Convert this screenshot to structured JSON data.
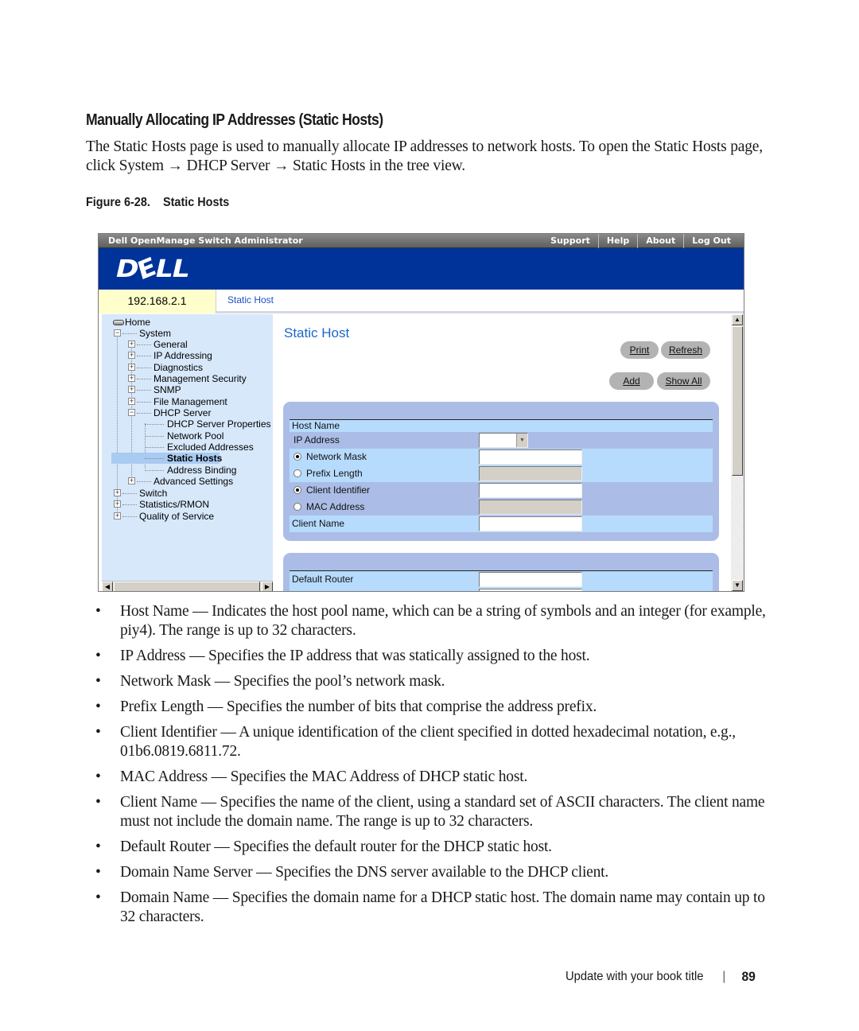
{
  "section_title": "Manually Allocating IP Addresses (Static Hosts)",
  "intro": {
    "p1": "The ",
    "b1": "Static Hosts",
    "p2": " page is used to manually allocate IP addresses to network hosts. To open the ",
    "b2": "Static Hosts",
    "p3": " page, click ",
    "b3": "System",
    "arrow1": " → ",
    "b4": "DHCP Server",
    "arrow2": " → ",
    "b5": "Static Hosts",
    "p4": " in the tree view."
  },
  "figure": {
    "number": "Figure 6-28.",
    "name": "Static Hosts"
  },
  "ui": {
    "app_title": "Dell OpenManage Switch Administrator",
    "top_links": [
      "Support",
      "Help",
      "About",
      "Log Out"
    ],
    "logo": {
      "d": "D",
      "e": "E",
      "ll": "LL"
    },
    "device_ip": "192.168.2.1",
    "breadcrumb": "Static Host",
    "tree": {
      "home": "Home",
      "system": "System",
      "general": "General",
      "ip_addressing": "IP Addressing",
      "diagnostics": "Diagnostics",
      "mgmt_security": "Management Security",
      "snmp": "SNMP",
      "file_mgmt": "File Management",
      "dhcp_server": "DHCP Server",
      "dhcp_props": "DHCP Server Properties",
      "network_pool": "Network Pool",
      "excluded": "Excluded Addresses",
      "static_hosts": "Static Hosts",
      "address_binding": "Address Binding",
      "advanced": "Advanced Settings",
      "switch": "Switch",
      "stats": "Statistics/RMON",
      "qos": "Quality of Service",
      "selected": "Static Hosts"
    },
    "page_heading": "Static Host",
    "buttons": {
      "print": "Print",
      "refresh": "Refresh",
      "add": "Add",
      "show_all": "Show All"
    },
    "form": {
      "host_name": "Host Name",
      "ip_address": "IP Address",
      "ip_address_value": "",
      "network_mask": "Network Mask",
      "network_mask_value": "",
      "network_mask_selected": true,
      "prefix_length": "Prefix Length",
      "prefix_length_selected": false,
      "client_identifier": "Client Identifier",
      "client_identifier_value": "",
      "client_identifier_selected": true,
      "mac_address": "MAC Address",
      "mac_address_selected": false,
      "client_name": "Client Name",
      "client_name_value": "",
      "default_router": "Default Router",
      "default_router_value": ""
    }
  },
  "bullets": [
    {
      "term": "Host Name",
      "desc": " — Indicates the host pool name, which can be a string of symbols and an integer (for example, piy4). The range is up to 32 characters."
    },
    {
      "term": "IP Address",
      "desc": " — Specifies the IP address that was statically assigned to the host."
    },
    {
      "term": "Network Mask",
      "desc": " — Specifies the pool’s network mask."
    },
    {
      "term": "Prefix Length",
      "desc": " — Specifies the number of bits that comprise the address prefix."
    },
    {
      "term": "Client Identifier",
      "desc": " — A unique identification of the client specified in dotted hexadecimal notation, e.g., 01b6.0819.6811.72."
    },
    {
      "term": "MAC Address",
      "desc": " — Specifies the MAC Address of DHCP static host."
    },
    {
      "term": "Client Name",
      "desc": " — Specifies the name of the client, using a standard set of ASCII characters. The client name must not include the domain name. The range is up to 32 characters."
    },
    {
      "term": "Default Router",
      "desc": " — Specifies the default router for the DHCP static host."
    },
    {
      "term": "Domain Name Server",
      "desc": " — Specifies the DNS server available to the DHCP client."
    },
    {
      "term": "Domain Name",
      "desc": " — Specifies the domain name for a DHCP static host. The domain name may contain up to 32 characters."
    }
  ],
  "bullet_char": "•",
  "footer": {
    "book_title": "Update with your book title",
    "separator": "|",
    "page_number": "89"
  }
}
